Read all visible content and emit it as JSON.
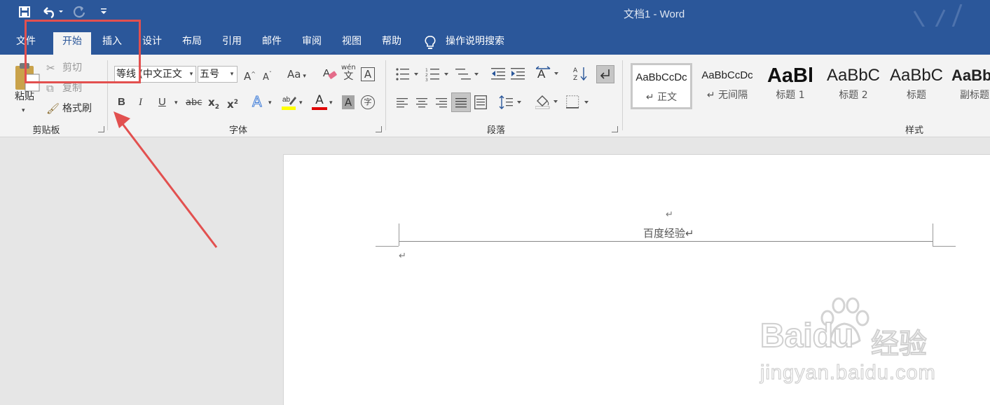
{
  "window": {
    "title": "文档1  -  Word"
  },
  "qat": {
    "save_icon": "save-icon",
    "undo_icon": "undo-icon",
    "redo_icon": "redo-icon",
    "customize_icon": "customize-icon"
  },
  "tabs": [
    {
      "label": "文件"
    },
    {
      "label": "开始"
    },
    {
      "label": "插入"
    },
    {
      "label": "设计"
    },
    {
      "label": "布局"
    },
    {
      "label": "引用"
    },
    {
      "label": "邮件"
    },
    {
      "label": "审阅"
    },
    {
      "label": "视图"
    },
    {
      "label": "帮助"
    }
  ],
  "tell_me": {
    "label": "操作说明搜索"
  },
  "clipboard": {
    "paste": "粘贴",
    "cut": "剪切",
    "copy": "复制",
    "format_painter": "格式刷",
    "group": "剪贴板"
  },
  "font": {
    "font_name": "等线 (中文正文",
    "font_size": "五号",
    "grow": "A",
    "shrink": "A",
    "change_case": "Aa",
    "phonetic": "wén",
    "bold": "B",
    "italic": "I",
    "underline": "U",
    "strike": "abc",
    "subscript": "x",
    "subscript_digit": "2",
    "superscript": "x",
    "superscript_digit": "2",
    "text_effects": "A",
    "font_color": "A",
    "char_shading": "A",
    "enclose": "字",
    "border_char": "A",
    "group": "字体"
  },
  "paragraph": {
    "group": "段落"
  },
  "styles": {
    "group": "样式",
    "items": [
      {
        "sample": "AaBbCcDc",
        "name": "↵ 正文"
      },
      {
        "sample": "AaBbCcDc",
        "name": "↵ 无间隔"
      },
      {
        "sample": "AaBl",
        "name": "标题 1"
      },
      {
        "sample": "AaBbC",
        "name": "标题 2"
      },
      {
        "sample": "AaBbC",
        "name": "标题"
      },
      {
        "sample": "AaBb",
        "name": "副标题"
      }
    ]
  },
  "document": {
    "header_mark": "↵",
    "header_text": "百度经验↵",
    "body_mark": "↵"
  },
  "watermark": {
    "brand": "Baidu",
    "brand_cn": "经验",
    "url": "jingyan.baidu.com"
  },
  "colors": {
    "word_blue": "#2b579a",
    "annotation_red": "#e2504f",
    "font_color_bar": "#e00000",
    "highlight_bar": "#ffff00"
  }
}
